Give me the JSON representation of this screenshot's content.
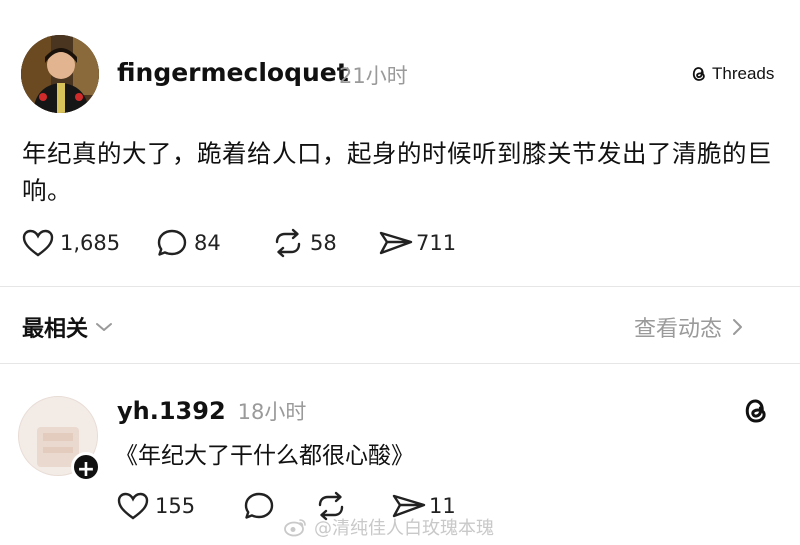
{
  "post": {
    "username": "fingermecloquet",
    "time": "21小时",
    "brand": "Threads",
    "text": "年纪真的大了，跪着给人口，起身的时候听到膝关节发出了清脆的巨响。",
    "likes": "1,685",
    "comments": "84",
    "reposts": "58",
    "shares": "711"
  },
  "section": {
    "sort_label": "最相关",
    "view_activity": "查看动态"
  },
  "reply": {
    "username": "yh.1392",
    "time": "18小时",
    "text": "《年纪大了干什么都很心酸》",
    "likes": "155",
    "shares": "11"
  },
  "watermark": "@清纯佳人白玫瑰本瑰"
}
